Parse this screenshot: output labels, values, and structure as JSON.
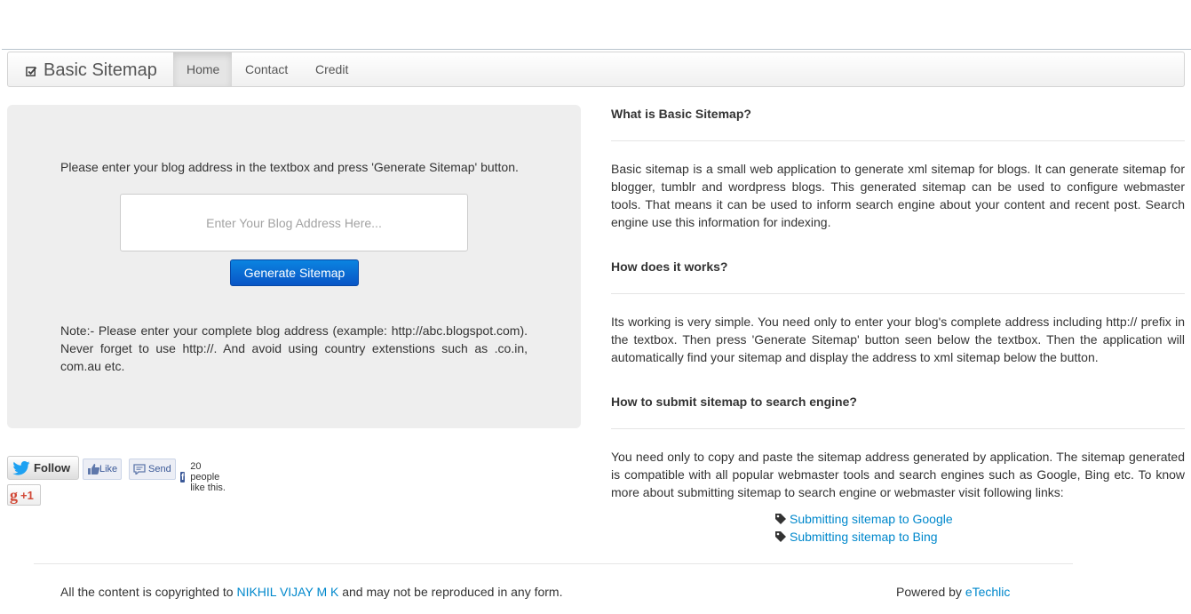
{
  "navbar": {
    "brand": "Basic Sitemap",
    "brand_icon": "checkbox-icon",
    "items": [
      {
        "label": "Home",
        "active": true
      },
      {
        "label": "Contact",
        "active": false
      },
      {
        "label": "Credit",
        "active": false
      }
    ]
  },
  "hero": {
    "intro": "Please enter your blog address in the textbox and press 'Generate Sitemap' button.",
    "input_placeholder": "Enter Your Blog Address Here...",
    "input_value": "",
    "button_label": "Generate Sitemap",
    "note": "Note:- Please enter your complete blog address (example: http://abc.blogspot.com). Never forget to use http://. And avoid using country extenstions such as .co.in, com.au etc."
  },
  "social": {
    "twitter_label": "Follow",
    "fb_like_label": "Like",
    "fb_send_label": "Send",
    "fb_count_text": "20 people like this.",
    "gplus_label": "+1"
  },
  "content": {
    "sections": [
      {
        "heading": "What is Basic Sitemap?",
        "body": "Basic sitemap is a small web application to generate xml sitemap for blogs. It can generate sitemap for blogger, tumblr and wordpress blogs. This generated sitemap can be used to configure webmaster tools. That means it can be used to inform search engine about your content and recent post. Search engine use this information for indexing."
      },
      {
        "heading": "How does it works?",
        "body": "Its working is very simple. You need only to enter your blog's complete address including http:// prefix in the textbox. Then press 'Generate Sitemap' button seen below the textbox. Then the application will automatically find your sitemap and display the address to xml sitemap below the button."
      },
      {
        "heading": "How to submit sitemap to search engine?",
        "body": "You need only to copy and paste the sitemap address generated by application. The sitemap generated is compatible with all popular webmaster tools and search engines such as Google, Bing etc. To know more about submitting sitemap to search engine or webmaster visit following links:"
      }
    ],
    "links": [
      "Submitting sitemap to Google",
      "Submitting sitemap to Bing"
    ]
  },
  "footer": {
    "copyright_prefix": "All the content is copyrighted to",
    "author": "NIKHIL VIJAY M K",
    "copyright_suffix": "and may not be reproduced in any form.",
    "powered_prefix": "Powered by",
    "powered_link": "eTechlic"
  },
  "colors": {
    "link": "#0088cc",
    "button": "#0955c6",
    "hero_bg": "#eeeeee"
  }
}
